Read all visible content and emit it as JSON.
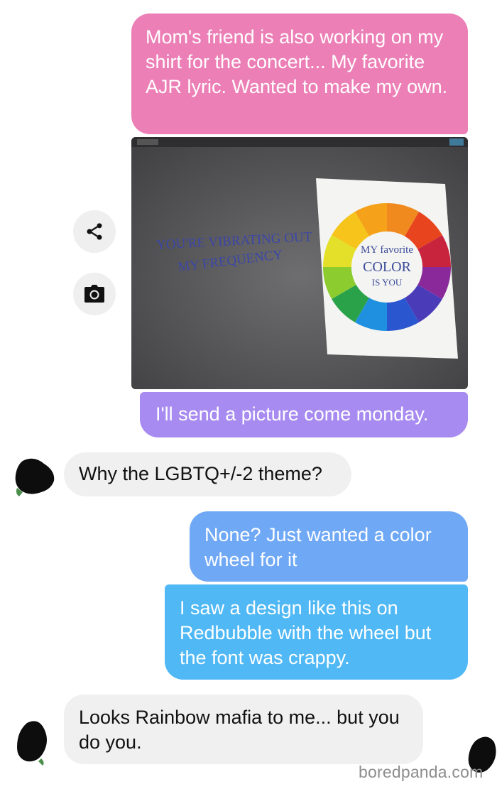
{
  "messages": [
    {
      "sender": "me",
      "text": "Mom's friend is also working on my shirt for the concert... My favorite AJR lyric. Wanted to make my own."
    },
    {
      "sender": "me",
      "text": "I'll send a picture come monday."
    },
    {
      "sender": "them",
      "text": "Why the LGBTQ+/-2 theme?"
    },
    {
      "sender": "me",
      "text": "None? Just wanted a color wheel for it"
    },
    {
      "sender": "me",
      "text": "I saw a design like this on Redbubble with the wheel but the font was crappy."
    },
    {
      "sender": "them",
      "text": "Looks Rainbow mafia to me... but you do you."
    }
  ],
  "photo": {
    "lyric_line1": "YOU'RE VIBRATING OUT",
    "lyric_line2": "MY FREQUENCY",
    "wheel_line1": "MY favorite",
    "wheel_line2": "COLOR",
    "wheel_line3": "IS YOU"
  },
  "actions": {
    "share_icon": "share-icon",
    "camera_icon": "camera-icon"
  },
  "watermark": "boredpanda.com",
  "colors": {
    "bubble_pink": "#ec7fb6",
    "bubble_purple": "#a78bf0",
    "bubble_blue": "#6fa8f5",
    "bubble_cyan": "#4fb8f5",
    "bubble_incoming": "#f0f0f0"
  }
}
